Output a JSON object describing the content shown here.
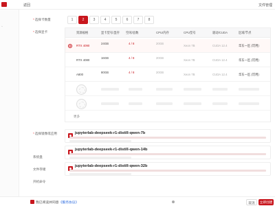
{
  "header": {
    "brand": "",
    "back_label": "返回",
    "right_label": "文件管理"
  },
  "form": {
    "labels": {
      "count": "选择卡数量",
      "instance": "选择显卡",
      "runtime": "选择镜像或应用",
      "system_disk": "系统盘",
      "storage": "文件存储",
      "startup": "开机命令"
    },
    "pages": [
      "1",
      "2",
      "3",
      "4",
      "5",
      "6",
      "7",
      "8"
    ],
    "active_page": "2"
  },
  "table": {
    "headers": [
      "资源规格",
      "显卡型号/显存",
      "空闲/总数",
      "CPU/内存",
      "CPU型号",
      "驱动/CUDA",
      "区域/节点"
    ],
    "rows": [
      {
        "gpu": "RTX 4090",
        "model": "24GB",
        "free": "4 / 8",
        "mem": "20GB",
        "cpu": "Xeon 7B",
        "driver": "CUDA 12.4",
        "region": "华东一区 (可用)",
        "selected": true
      },
      {
        "gpu": "RTX 4080",
        "model": "16GB",
        "free": "4 / 8",
        "mem": "20GB",
        "cpu": "Xeon 7B",
        "driver": "CUDA 12.4",
        "region": "华东一区 (可用)",
        "selected": false
      },
      {
        "gpu": "A800",
        "model": "80GB",
        "free": "4 / 8",
        "mem": "20GB",
        "cpu": "Xeon 7B",
        "driver": "CUDA 12.4",
        "region": "华东一区 (可用)",
        "selected": false
      }
    ],
    "more_label": "更多"
  },
  "apps": [
    {
      "name": "jupyterlab-deepseek-r1-distill-qwen-7b"
    },
    {
      "name": "jupyterlab-deepseek-r1-distill-qwen-14b"
    },
    {
      "name": "jupyterlab-deepseek-r1-distill-qwen-32b"
    }
  ],
  "footer": {
    "agree_text": "我已阅读并同意",
    "agree_link": "《服务协议》",
    "info": "",
    "cancel": "取消",
    "confirm": "立即创建"
  },
  "colors": {
    "accent": "#c8161d",
    "link": "#2d6cdf"
  }
}
